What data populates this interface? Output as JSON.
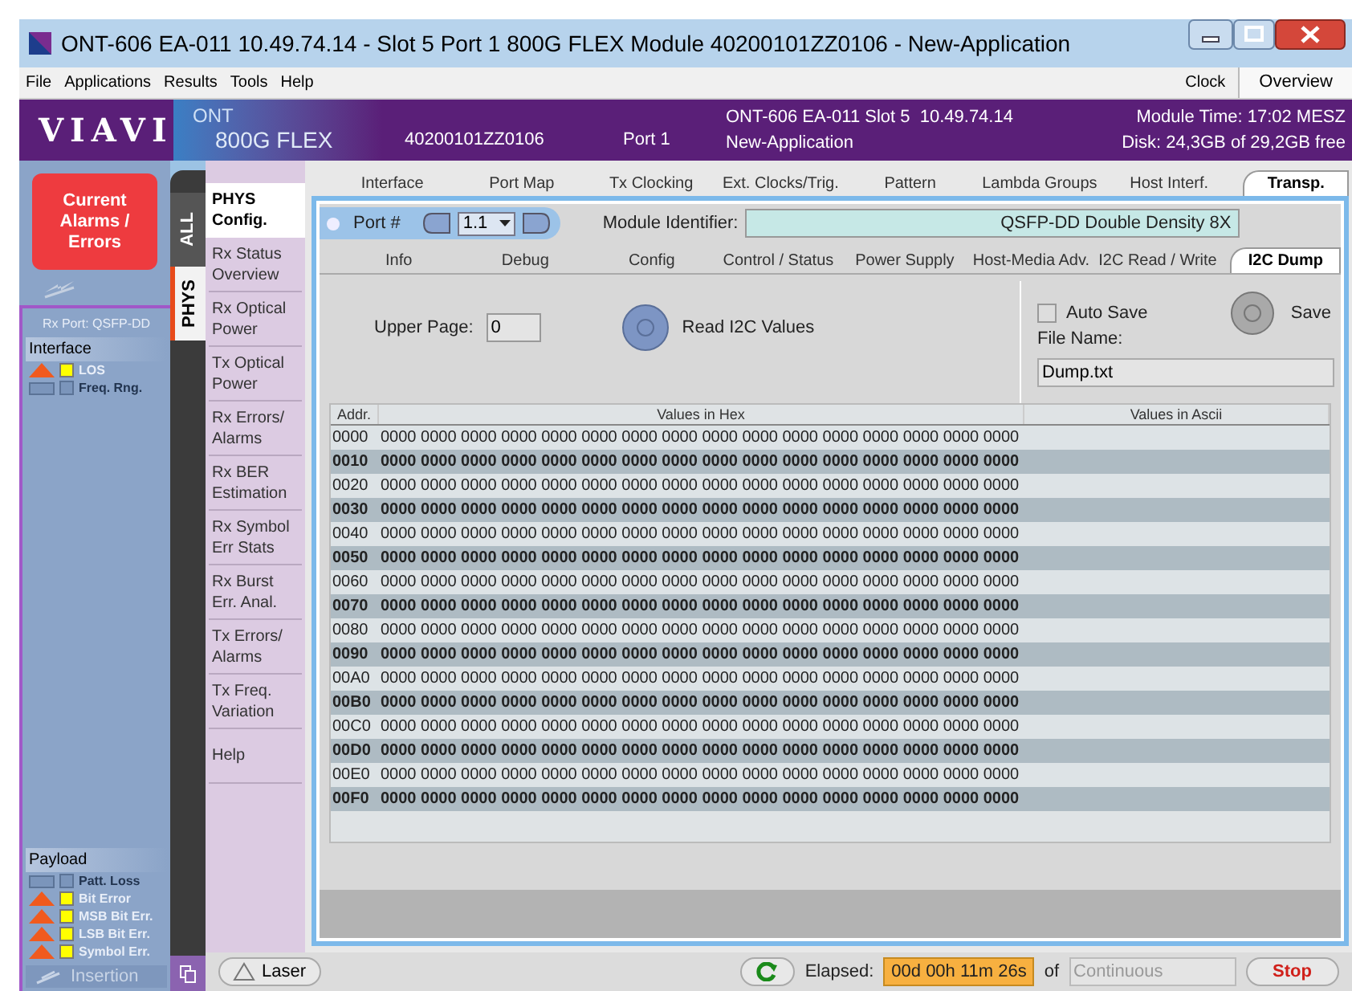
{
  "window": {
    "title": "ONT-606  EA-011 10.49.74.14 - Slot 5 Port 1 800G FLEX Module 40200101ZZ0106 - New-Application"
  },
  "menu": {
    "items": [
      "File",
      "Applications",
      "Results",
      "Tools",
      "Help"
    ],
    "clock": "Clock",
    "overview": "Overview"
  },
  "header": {
    "logo": "VIAVI",
    "product_line": "ONT",
    "product": "800G FLEX",
    "serial": "40200101ZZ0106",
    "port": "Port 1",
    "device": "ONT-606 EA-011 Slot 5  10.49.74.14",
    "application": "New-Application",
    "module_time": "Module Time: 17:02 MESZ",
    "disk": "Disk: 24,3GB of 29,2GB free"
  },
  "alarms_button": "Current Alarms / Errors",
  "status_panel": {
    "port": "Rx Port: QSFP-DD",
    "groups": [
      {
        "title": "Interface",
        "items": [
          {
            "label": "LOS",
            "active": true
          },
          {
            "label": "Freq. Rng.",
            "active": false
          }
        ]
      },
      {
        "title": "Payload",
        "items": [
          {
            "label": "Patt. Loss",
            "active": false
          },
          {
            "label": "Bit Error",
            "active": true
          },
          {
            "label": "MSB Bit Err.",
            "active": true
          },
          {
            "label": "LSB Bit Err.",
            "active": true
          },
          {
            "label": "Symbol Err.",
            "active": true
          }
        ]
      }
    ],
    "insertion": "Insertion"
  },
  "vertical_tabs": [
    {
      "label": "ALL",
      "selected": false
    },
    {
      "label": "PHYS",
      "selected": true
    }
  ],
  "side_nav": [
    {
      "label": "PHYS Config.",
      "selected": true
    },
    {
      "label": "Rx Status Overview",
      "selected": false
    },
    {
      "label": "Rx Optical Power",
      "selected": false
    },
    {
      "label": "Tx Optical Power",
      "selected": false
    },
    {
      "label": "Rx Errors/ Alarms",
      "selected": false
    },
    {
      "label": "Rx BER Estimation",
      "selected": false
    },
    {
      "label": "Rx Symbol Err Stats",
      "selected": false
    },
    {
      "label": "Rx Burst Err. Anal.",
      "selected": false
    },
    {
      "label": "Tx Errors/ Alarms",
      "selected": false
    },
    {
      "label": "Tx Freq. Variation",
      "selected": false
    },
    {
      "label": "Help",
      "selected": false
    }
  ],
  "top_tabs": [
    {
      "label": "Interface",
      "selected": false
    },
    {
      "label": "Port Map",
      "selected": false
    },
    {
      "label": "Tx Clocking",
      "selected": false
    },
    {
      "label": "Ext. Clocks/Trig.",
      "selected": false
    },
    {
      "label": "Pattern",
      "selected": false
    },
    {
      "label": "Lambda Groups",
      "selected": false
    },
    {
      "label": "Host Interf.",
      "selected": false
    },
    {
      "label": "Transp.",
      "selected": true
    }
  ],
  "port": {
    "label": "Port #",
    "value": "1.1"
  },
  "module_identifier": {
    "label": "Module Identifier:",
    "value": "QSFP-DD Double Density 8X"
  },
  "sub_tabs": [
    {
      "label": "Info",
      "selected": false
    },
    {
      "label": "Debug",
      "selected": false
    },
    {
      "label": "Config",
      "selected": false
    },
    {
      "label": "Control / Status",
      "selected": false
    },
    {
      "label": "Power Supply",
      "selected": false
    },
    {
      "label": "Host-Media Adv.",
      "selected": false
    },
    {
      "label": "I2C Read / Write",
      "selected": false
    },
    {
      "label": "I2C Dump",
      "selected": true
    }
  ],
  "upper_page": {
    "label": "Upper Page:",
    "value": "0"
  },
  "read_button": "Read I2C Values",
  "auto_save": {
    "label": "Auto Save",
    "checked": false
  },
  "save_button": "Save",
  "file_name": {
    "label": "File Name:",
    "value": "Dump.txt"
  },
  "table": {
    "columns": [
      "Addr.",
      "Values in Hex",
      "Values in Ascii"
    ],
    "rows": [
      {
        "addr": "0000",
        "hex": "0000 0000 0000 0000 0000 0000 0000 0000 0000 0000 0000 0000 0000 0000 0000 0000"
      },
      {
        "addr": "0010",
        "hex": "0000 0000 0000 0000 0000 0000 0000 0000 0000 0000 0000 0000 0000 0000 0000 0000"
      },
      {
        "addr": "0020",
        "hex": "0000 0000 0000 0000 0000 0000 0000 0000 0000 0000 0000 0000 0000 0000 0000 0000"
      },
      {
        "addr": "0030",
        "hex": "0000 0000 0000 0000 0000 0000 0000 0000 0000 0000 0000 0000 0000 0000 0000 0000"
      },
      {
        "addr": "0040",
        "hex": "0000 0000 0000 0000 0000 0000 0000 0000 0000 0000 0000 0000 0000 0000 0000 0000"
      },
      {
        "addr": "0050",
        "hex": "0000 0000 0000 0000 0000 0000 0000 0000 0000 0000 0000 0000 0000 0000 0000 0000"
      },
      {
        "addr": "0060",
        "hex": "0000 0000 0000 0000 0000 0000 0000 0000 0000 0000 0000 0000 0000 0000 0000 0000"
      },
      {
        "addr": "0070",
        "hex": "0000 0000 0000 0000 0000 0000 0000 0000 0000 0000 0000 0000 0000 0000 0000 0000"
      },
      {
        "addr": "0080",
        "hex": "0000 0000 0000 0000 0000 0000 0000 0000 0000 0000 0000 0000 0000 0000 0000 0000"
      },
      {
        "addr": "0090",
        "hex": "0000 0000 0000 0000 0000 0000 0000 0000 0000 0000 0000 0000 0000 0000 0000 0000"
      },
      {
        "addr": "00A0",
        "hex": "0000 0000 0000 0000 0000 0000 0000 0000 0000 0000 0000 0000 0000 0000 0000 0000"
      },
      {
        "addr": "00B0",
        "hex": "0000 0000 0000 0000 0000 0000 0000 0000 0000 0000 0000 0000 0000 0000 0000 0000"
      },
      {
        "addr": "00C0",
        "hex": "0000 0000 0000 0000 0000 0000 0000 0000 0000 0000 0000 0000 0000 0000 0000 0000"
      },
      {
        "addr": "00D0",
        "hex": "0000 0000 0000 0000 0000 0000 0000 0000 0000 0000 0000 0000 0000 0000 0000 0000"
      },
      {
        "addr": "00E0",
        "hex": "0000 0000 0000 0000 0000 0000 0000 0000 0000 0000 0000 0000 0000 0000 0000 0000"
      },
      {
        "addr": "00F0",
        "hex": "0000 0000 0000 0000 0000 0000 0000 0000 0000 0000 0000 0000 0000 0000 0000 0000"
      }
    ]
  },
  "footer": {
    "laser": "Laser",
    "elapsed_label": "Elapsed:",
    "elapsed": "00d 00h 11m 26s",
    "of": "of",
    "duration": "Continuous",
    "stop": "Stop"
  }
}
